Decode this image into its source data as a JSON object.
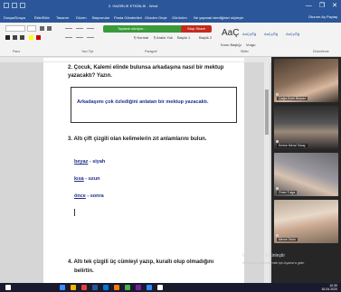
{
  "titlebar": {
    "doc_title": "2. HAZIRLIK ETKİNLİK - Word",
    "controls": [
      "—",
      "❐",
      "✕"
    ]
  },
  "menu": {
    "tabs": [
      "Dosya/Dosya",
      "Ekle/Ekle",
      "Tasarım",
      "Düzen",
      "Başvurular",
      "Posta Gönderileri",
      "Gözden Geçir",
      "Görünüm",
      "Ne yapmak istediğinizi söyleyin"
    ],
    "share": "Oturum Aç  Paylaş"
  },
  "ribbon": {
    "meeting_label": "Toplantı sürüyor...",
    "stop_share": "Stop Share",
    "styles": [
      "¶ Normal",
      "¶ Aralık Yok",
      "Başlık 1",
      "Başlık 2",
      "Konu Başlığı",
      "Vurgu"
    ],
    "style_preview": "AaÇ",
    "heading_samples": [
      "AaÇçĞğ",
      "AaÇçĞğ",
      "AaÇçĞğ"
    ],
    "groups": [
      "Pano",
      "Yazı Tipi",
      "Paragraf",
      "Stiller",
      "Düzenleme"
    ]
  },
  "document": {
    "q2_text": "2. Çocuk, Kalemi elinde bulunsa arkadaşına nasıl bir mektup yazacaktı? Yazın.",
    "answer_text": "Arkadaşımı çok özlediğini anlatan bir mektup yazacaktı.",
    "q3_text": "3. Altı çift çizgili olan kelimelerin zıt anlamlarını bulun.",
    "pairs": [
      {
        "word": "beyaz",
        "sep": " - ",
        "answer": "siyah"
      },
      {
        "word": "kısa",
        "sep": " - ",
        "answer": "uzun"
      },
      {
        "word": "önce",
        "sep": " - ",
        "answer": "sonra"
      }
    ],
    "q4_text": "4. Altı tek çizgili üç cümleyi yazıp, kurallı olup olmadığını",
    "q4_cont": "belirtin."
  },
  "participants": [
    {
      "name": "Çağla Ecrin Boyraz",
      "color": "#5b4a3a"
    },
    {
      "name": "Emine Meral Tokay",
      "color": "#3a3a3a"
    },
    {
      "name": "Ömer Tulga",
      "color": "#6b6b70"
    },
    {
      "name": "Merve Tekin",
      "color": "#8a7a6b"
    }
  ],
  "watermark": {
    "line1": "Windows'u Etkinleştir",
    "line2": "Windows'u etkinleştirmek için Ayarlar'a gidin."
  },
  "taskbar": {
    "time": "10:39",
    "date": "16.04.2020",
    "icon_colors": [
      "#ffffff",
      "#3d8bfd",
      "#f4b400",
      "#e94235",
      "#2b579a",
      "#0078d4",
      "#ff7a00",
      "#4caf50",
      "#7b1fa2",
      "#2d8cff"
    ]
  }
}
